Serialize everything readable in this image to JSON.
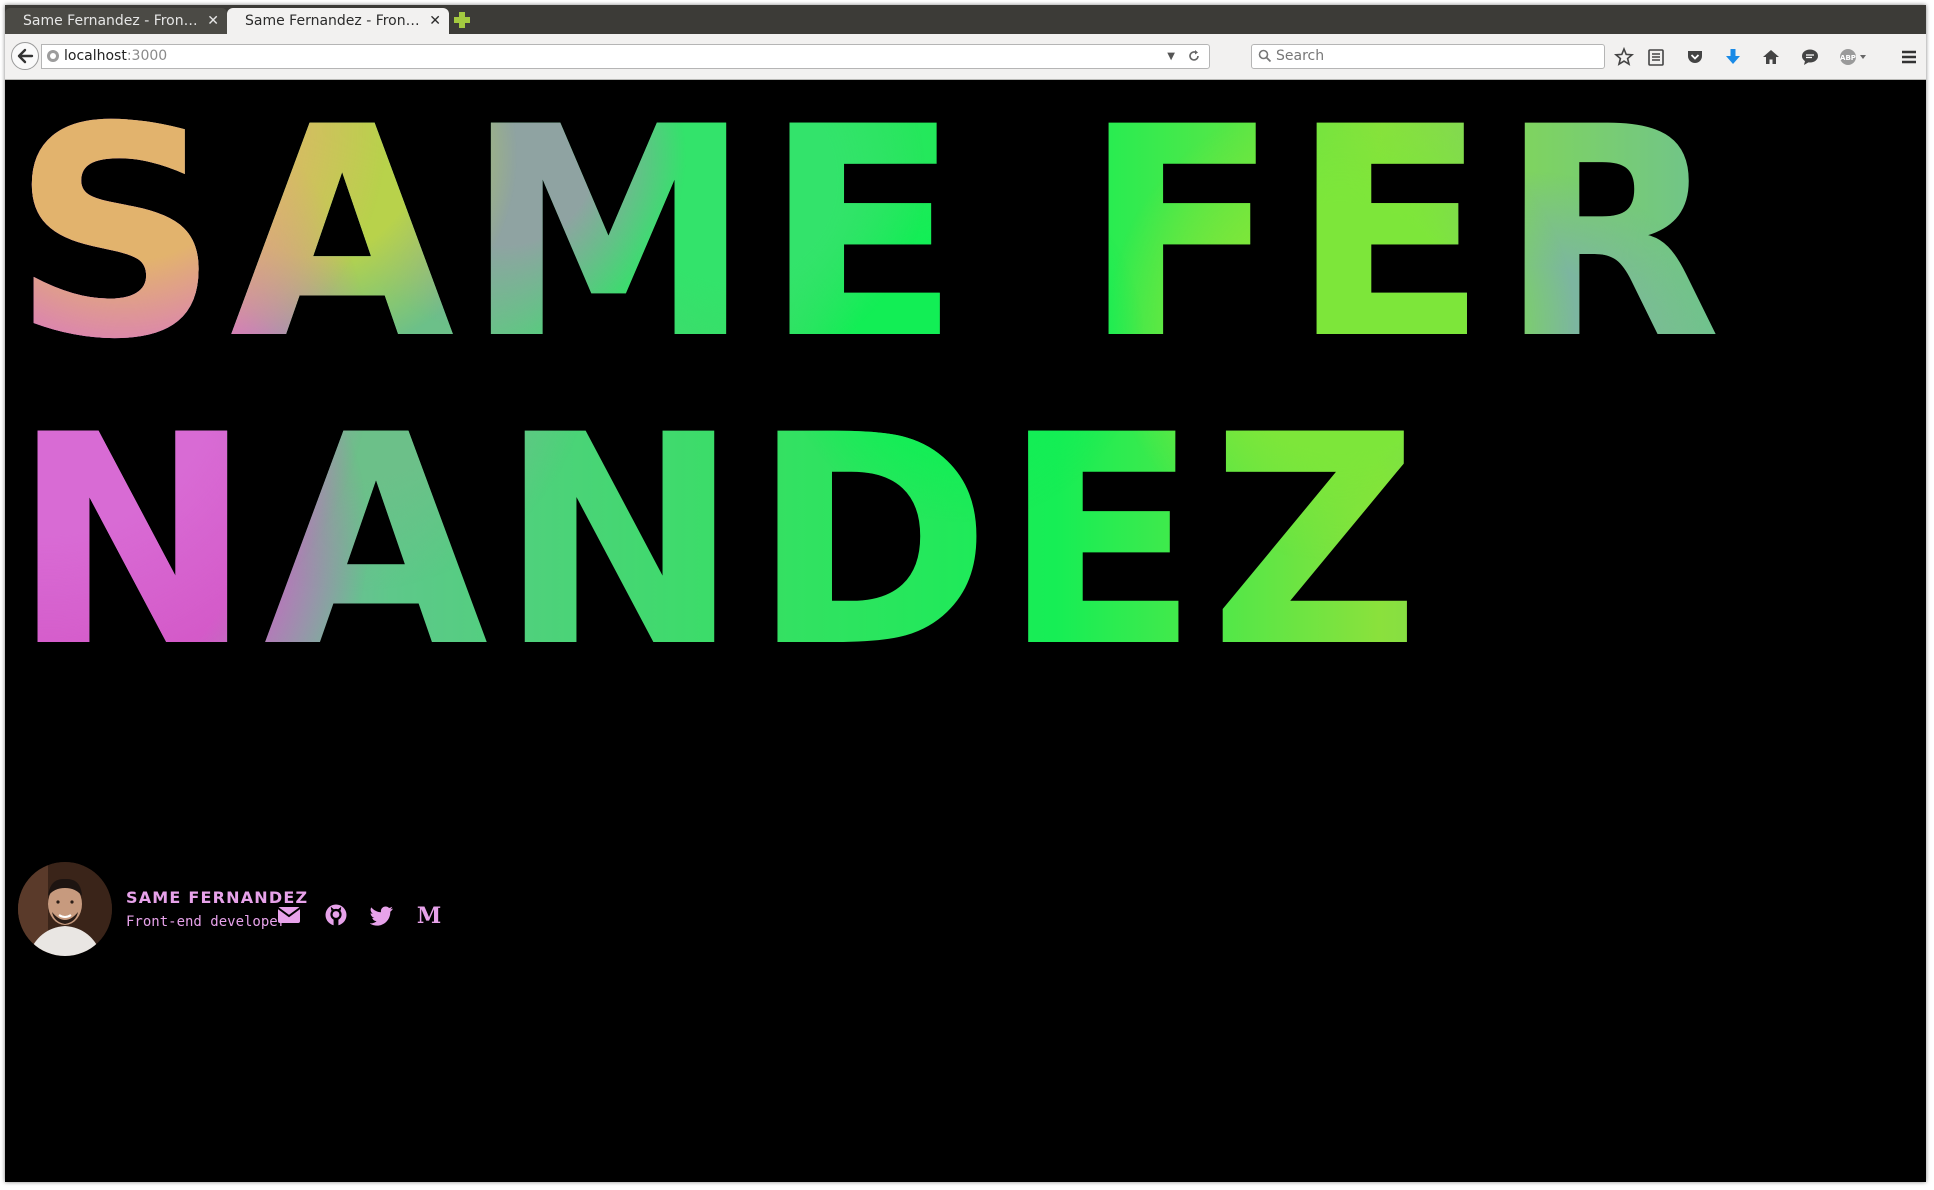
{
  "browser": {
    "tabs": [
      {
        "label": "Same Fernandez - Front...",
        "active": false
      },
      {
        "label": "Same Fernandez - Front...",
        "active": true
      }
    ],
    "url_host": "localhost",
    "url_port": ":3000",
    "search_placeholder": "Search",
    "toolbar_icons": [
      "star-icon",
      "reading-list-icon",
      "pocket-icon",
      "download-icon",
      "home-icon",
      "chat-icon",
      "adblock-icon",
      "menu-icon"
    ]
  },
  "hero": {
    "title": "SAME FERNANDEZ"
  },
  "profile": {
    "name": "SAME FERNANDEZ",
    "role": "Front-end developer",
    "social_icons": [
      "mail-icon",
      "github-icon",
      "twitter-icon",
      "medium-icon"
    ]
  },
  "colors": {
    "accent": "#e7a2ea",
    "background": "#000000",
    "gradient": [
      "#e2b36d",
      "#d86bd4",
      "#b8d24b",
      "#12ee55",
      "#7de63a",
      "#8fa3a2"
    ]
  }
}
